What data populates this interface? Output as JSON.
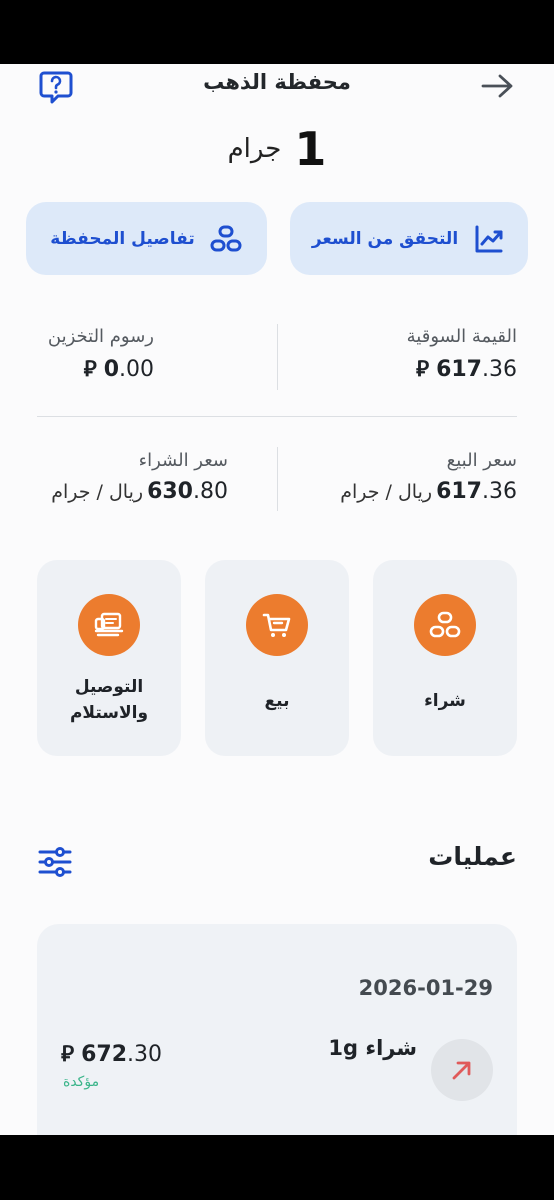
{
  "header": {
    "title": "محفظة الذهب",
    "help_icon": "help-question-icon",
    "back_icon": "arrow-right-icon"
  },
  "balance": {
    "amount": "1",
    "unit": "جرام"
  },
  "actions": {
    "verify_price": "التحقق من السعر",
    "wallet_details": "تفاصيل المحفظة"
  },
  "stats": {
    "market_value_label": "القيمة السوقية",
    "market_value_int": "617",
    "market_value_frac": ".36",
    "storage_fees_label": "رسوم التخزين",
    "storage_fees_int": "0",
    "storage_fees_frac": ".00",
    "sell_price_label": "سعر البيع",
    "sell_price_int": "617",
    "sell_price_frac": ".36",
    "buy_price_label": "سعر الشراء",
    "buy_price_int": "630",
    "buy_price_frac": ".80",
    "per_gram_unit": "ريال / جرام",
    "currency_symbol": "⃁"
  },
  "tiles": {
    "buy": "شراء",
    "sell": "بيع",
    "delivery_line1": "التوصيل",
    "delivery_line2": "والاستلام"
  },
  "transactions": {
    "title": "عمليات",
    "items": [
      {
        "date": "2026-01-29",
        "title": "شراء 1g",
        "amount_int": "672",
        "amount_frac": ".30",
        "status": "مؤكدة"
      }
    ]
  },
  "colors": {
    "accent_blue": "#1e4fd0",
    "button_bg": "#dde9f9",
    "orange": "#ec7c2e",
    "status_green": "#3bb58a",
    "arrow_red": "#e05a5a"
  }
}
